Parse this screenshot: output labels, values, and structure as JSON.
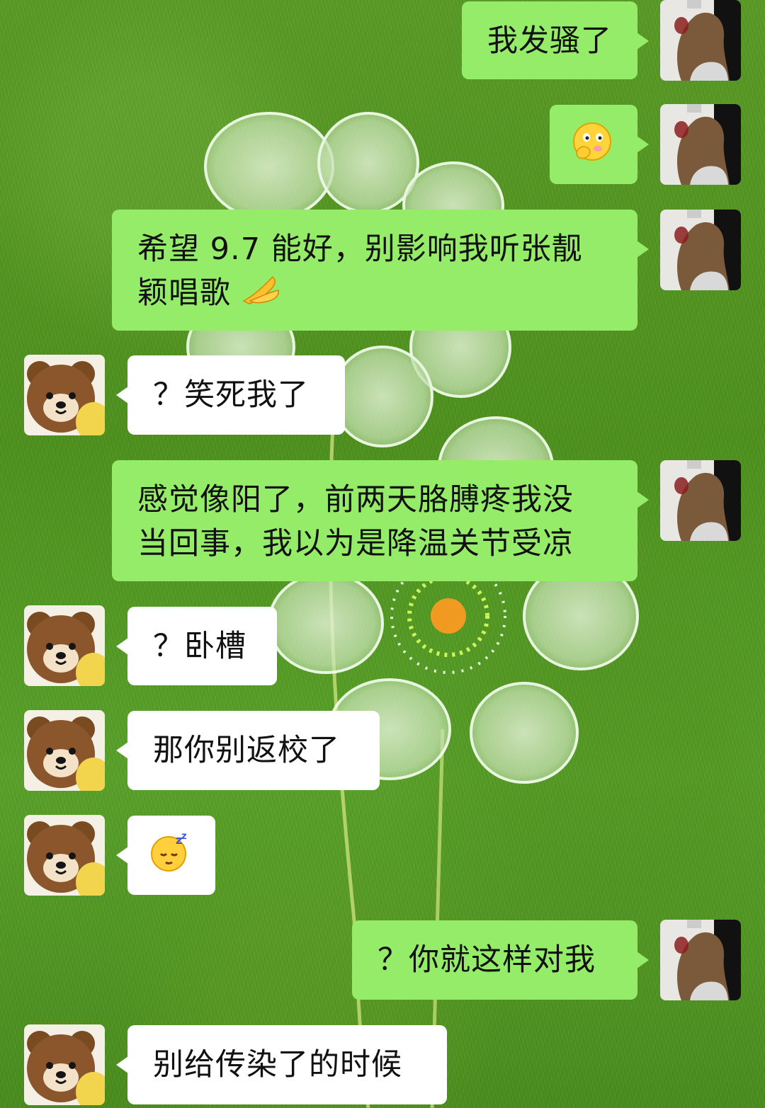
{
  "chat": {
    "messages": [
      {
        "sender": "me",
        "text": "我发骚了"
      },
      {
        "sender": "me",
        "emoji": "face-with-hand-over-mouth-emoji"
      },
      {
        "sender": "me",
        "text_line1": "希望 9.7 能好，别影响我听张靓",
        "text_line2": "颖唱歌",
        "emoji": "folded-hands-emoji"
      },
      {
        "sender": "friend",
        "text": "？笑死我了"
      },
      {
        "sender": "me",
        "text_line1": "感觉像阳了，前两天胳膊疼我没",
        "text_line2": "当回事，我以为是降温关节受凉"
      },
      {
        "sender": "friend",
        "text": "？卧槽"
      },
      {
        "sender": "friend",
        "text": "那你别返校了"
      },
      {
        "sender": "friend",
        "emoji": "sleeping-face-emoji"
      },
      {
        "sender": "me",
        "text": "？你就这样对我"
      },
      {
        "sender": "friend",
        "text": "别给传染了的时候"
      }
    ]
  },
  "colors": {
    "my_bubble": "#95ec69",
    "friend_bubble": "#ffffff",
    "background_green": "#4f9120"
  }
}
